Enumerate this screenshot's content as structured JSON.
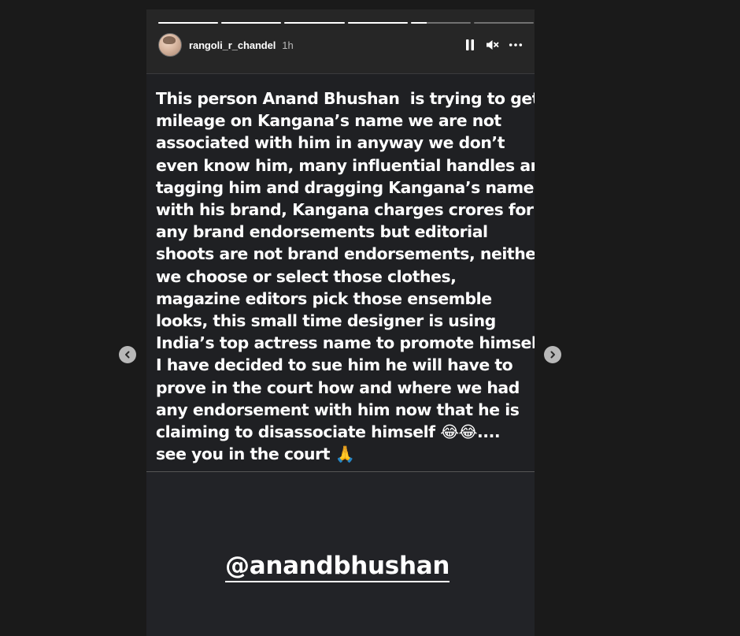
{
  "story": {
    "progress": [
      1,
      1,
      1,
      1,
      0.27,
      0
    ],
    "username": "rangoli_r_chandel",
    "time_ago": "1h",
    "text_lines": [
      "This person Anand Bhushan  is trying to get",
      "mileage on Kangana’s name we are not",
      "associated with him in anyway we don’t",
      "even know him, many influential handles are",
      "tagging him and dragging Kangana’s name",
      "with his brand, Kangana charges crores for",
      "any brand endorsements but editorial",
      "shoots are not brand endorsements, neither",
      "we choose or select those clothes,",
      "magazine editors pick those ensemble",
      "looks, this small time designer is using",
      "India’s top actress name to promote himself",
      "I have decided to sue him he will have to",
      "prove in the court how and where we had",
      "any endorsement with him now that he is",
      "claiming to disassociate himself 😂😂....",
      "see you in the court 🙏"
    ],
    "mention": "@anandbhushan"
  },
  "controls": {
    "pause_icon": "pause-icon",
    "mute_icon": "muted-speaker-icon",
    "more_icon": "more-options-icon"
  },
  "navigation": {
    "prev_icon": "chevron-left-icon",
    "next_icon": "chevron-right-icon"
  }
}
